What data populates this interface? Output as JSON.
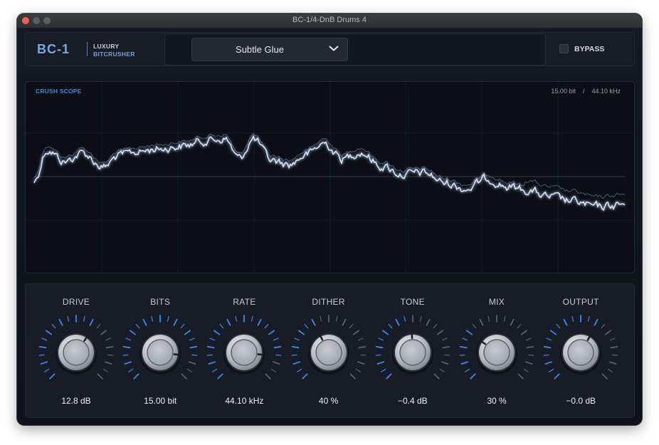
{
  "window": {
    "title": "BC-1/4-DnB Drums 4"
  },
  "header": {
    "logo": "BC-1",
    "tagline_top": "LUXURY",
    "tagline_bottom": "BITCRUSHER",
    "preset": "Subtle Glue",
    "bypass_label": "BYPASS"
  },
  "scope": {
    "title": "CRUSH SCOPE",
    "bits_readout": "15.00 bit",
    "separator": "/",
    "rate_readout": "44.10 kHz"
  },
  "knobs": [
    {
      "label": "DRIVE",
      "value": "12.8 dB",
      "position": 0.63
    },
    {
      "label": "BITS",
      "value": "15.00 bit",
      "position": 0.86
    },
    {
      "label": "RATE",
      "value": "44.10 kHz",
      "position": 0.86
    },
    {
      "label": "DITHER",
      "value": "40 %",
      "position": 0.4
    },
    {
      "label": "TONE",
      "value": "−0.4 dB",
      "position": 0.49
    },
    {
      "label": "MIX",
      "value": "30 %",
      "position": 0.3
    },
    {
      "label": "OUTPUT",
      "value": "−0.0 dB",
      "position": 0.61
    }
  ],
  "colors": {
    "accent": "#5a9cff",
    "waveform": "#d4e4ff",
    "tick_active": "#3f86f2",
    "tick_inactive": "#5b606a"
  }
}
